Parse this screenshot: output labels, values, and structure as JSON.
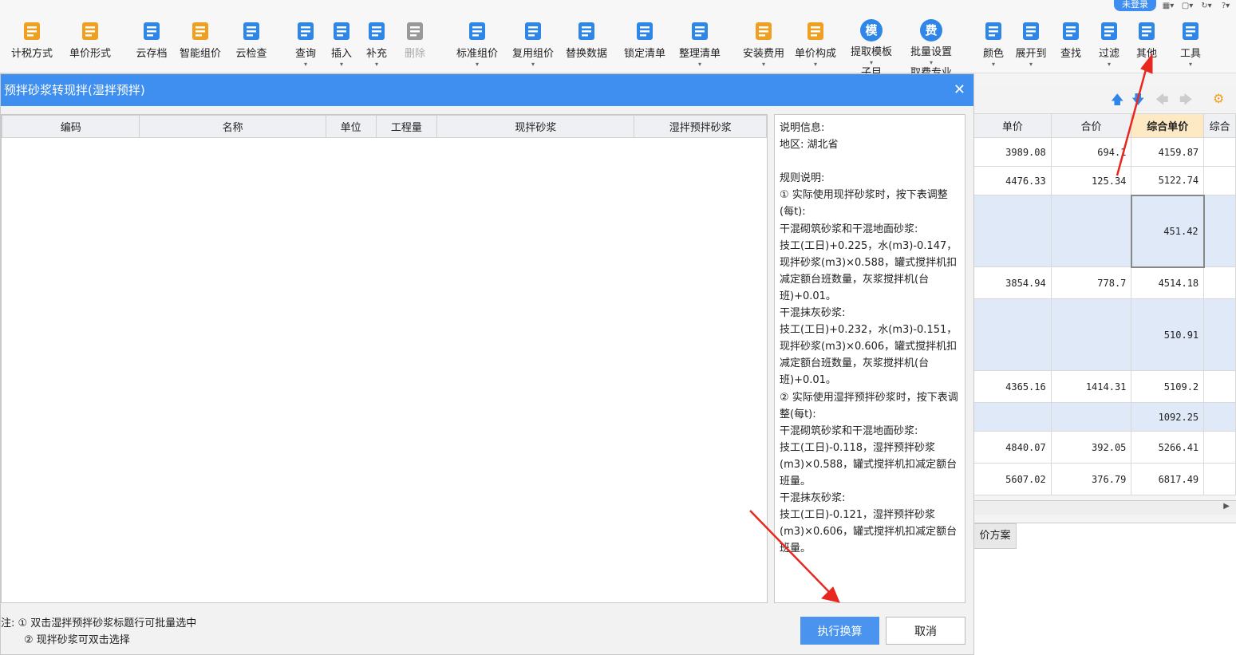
{
  "login": {
    "label": "未登录"
  },
  "toolbar": {
    "items": [
      {
        "label": "计税方式",
        "icon": "tax-mode-icon",
        "color": "#f0a020"
      },
      {
        "label": "单价形式",
        "icon": "price-form-icon",
        "color": "#f0a020"
      },
      {
        "label": "云存档",
        "icon": "cloud-save-icon",
        "color": "#2e86e8"
      },
      {
        "label": "智能组价",
        "icon": "smart-pricing-icon",
        "color": "#f0a020"
      },
      {
        "label": "云检查",
        "icon": "cloud-check-icon",
        "color": "#2e86e8"
      },
      {
        "label": "查询",
        "icon": "query-icon",
        "color": "#2e86e8"
      },
      {
        "label": "插入",
        "icon": "insert-icon",
        "color": "#2e86e8"
      },
      {
        "label": "补充",
        "icon": "supplement-icon",
        "color": "#2e86e8"
      },
      {
        "label": "删除",
        "icon": "delete-icon",
        "color": "#999999"
      },
      {
        "label": "标准组价",
        "icon": "standard-pricing-icon",
        "color": "#2e86e8"
      },
      {
        "label": "复用组价",
        "icon": "reuse-pricing-icon",
        "color": "#2e86e8"
      },
      {
        "label": "替换数据",
        "icon": "replace-data-icon",
        "color": "#2e86e8"
      },
      {
        "label": "锁定清单",
        "icon": "lock-list-icon",
        "color": "#2e86e8"
      },
      {
        "label": "整理清单",
        "icon": "organize-list-icon",
        "color": "#2e86e8"
      },
      {
        "label": "安装费用",
        "icon": "install-cost-icon",
        "color": "#f0a020"
      },
      {
        "label": "单价构成",
        "icon": "price-composition-icon",
        "color": "#f0a020"
      },
      {
        "label": "提取模板",
        "icon": "extract-template-icon",
        "color": "#2e86e8",
        "glyph": "模"
      },
      {
        "label": "批量设置",
        "icon": "batch-set-icon",
        "color": "#2e86e8",
        "glyph": "费"
      },
      {
        "label": "颜色",
        "icon": "color-icon",
        "color": "#2e86e8"
      },
      {
        "label": "展开到",
        "icon": "expand-to-icon",
        "color": "#2e86e8"
      },
      {
        "label": "查找",
        "icon": "find-icon",
        "color": "#2e86e8"
      },
      {
        "label": "过滤",
        "icon": "filter-icon",
        "color": "#2e86e8"
      },
      {
        "label": "其他",
        "icon": "other-icon",
        "color": "#2e86e8"
      },
      {
        "label": "工具",
        "icon": "tools-icon",
        "color": "#2e86e8"
      }
    ],
    "partial_labels": [
      "子目",
      "取费专业"
    ]
  },
  "background_table": {
    "headers": [
      "单价",
      "合价",
      "综合单价",
      "综合"
    ],
    "rows": [
      {
        "unit_price": "3989.08",
        "total": "694.1",
        "composite": "4159.87",
        "blue": false
      },
      {
        "unit_price": "4476.33",
        "total": "125.34",
        "composite": "5122.74",
        "blue": false
      },
      {
        "unit_price": "",
        "total": "",
        "composite": "451.42",
        "blue": true
      },
      {
        "unit_price": "3854.94",
        "total": "778.7",
        "composite": "4514.18",
        "blue": false
      },
      {
        "unit_price": "",
        "total": "",
        "composite": "510.91",
        "blue": true
      },
      {
        "unit_price": "4365.16",
        "total": "1414.31",
        "composite": "5109.2",
        "blue": false
      },
      {
        "unit_price": "",
        "total": "",
        "composite": "1092.25",
        "blue": true
      },
      {
        "unit_price": "4840.07",
        "total": "392.05",
        "composite": "5266.41",
        "blue": false
      },
      {
        "unit_price": "5607.02",
        "total": "376.79",
        "composite": "6817.49",
        "blue": false
      }
    ],
    "bottom_tab": "价方案"
  },
  "dialog": {
    "title": "预拌砂浆转现拌(湿拌预拌)",
    "columns": [
      "编码",
      "名称",
      "单位",
      "工程量",
      "现拌砂浆",
      "湿拌预拌砂浆"
    ],
    "info_text": "说明信息:\n地区: 湖北省\n\n规则说明:\n① 实际使用现拌砂浆时，按下表调整(每t):\n干混砌筑砂浆和干混地面砂浆:\n技工(工日)+0.225，水(m3)-0.147，现拌砂浆(m3)×0.588，罐式搅拌机扣减定额台班数量，灰浆搅拌机(台班)+0.01。\n干混抹灰砂浆:\n技工(工日)+0.232，水(m3)-0.151，现拌砂浆(m3)×0.606，罐式搅拌机扣减定额台班数量，灰浆搅拌机(台班)+0.01。\n② 实际使用湿拌预拌砂浆时，按下表调整(每t):\n干混砌筑砂浆和干混地面砂浆:\n技工(工日)-0.118，湿拌预拌砂浆(m3)×0.588，罐式搅拌机扣减定额台班量。\n干混抹灰砂浆:\n技工(工日)-0.121，湿拌预拌砂浆(m3)×0.606，罐式搅拌机扣减定额台班量。",
    "note1": "注: ① 双击湿拌预拌砂浆标题行可批量选中",
    "note2": "② 现拌砂浆可双击选择",
    "execute_label": "执行换算",
    "cancel_label": "取消"
  },
  "colors": {
    "accent": "#3e8ff0",
    "annotation": "#e8281e",
    "highlight_header": "#fde9c3",
    "selected_row": "#dfe9f8"
  }
}
